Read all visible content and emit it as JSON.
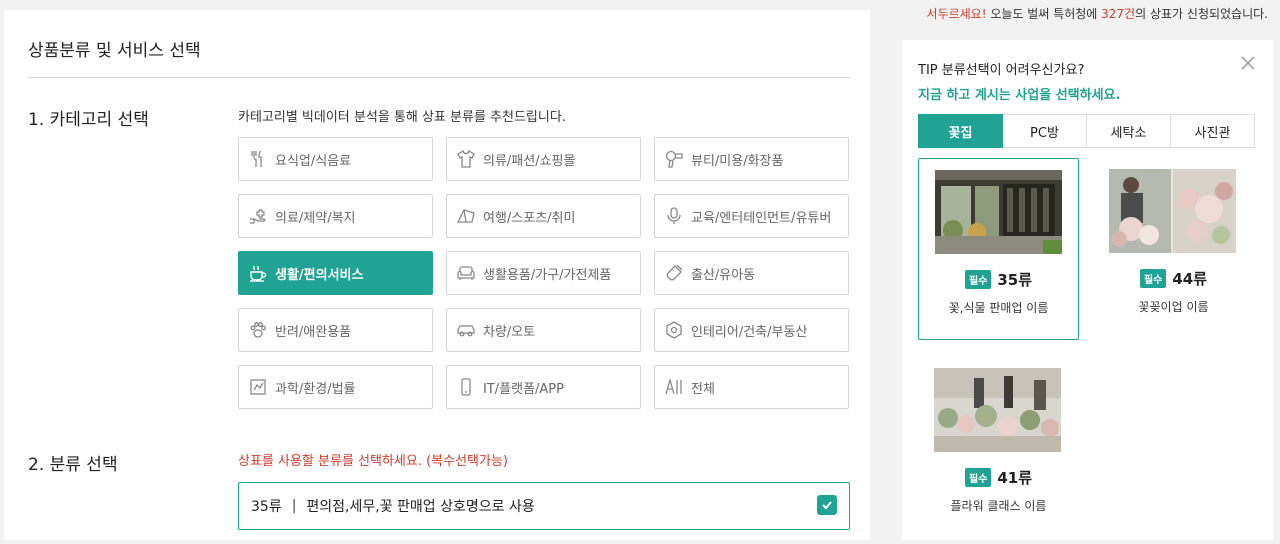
{
  "urgency": {
    "prefix": "서두르세요!",
    "middle": " 오늘도 벌써 특허청에 ",
    "count": "327건",
    "suffix": "의 상표가 신청되었습니다."
  },
  "page": {
    "title": "상품분류 및 서비스 선택"
  },
  "section1": {
    "title": "1. 카테고리 선택",
    "description": "카테고리별 빅데이터 분석을 통해 상표 분류를 추천드립니다."
  },
  "categories": [
    {
      "label": "요식업/식음료",
      "icon": "utensils-icon"
    },
    {
      "label": "의류/패션/쇼핑몰",
      "icon": "shirt-icon"
    },
    {
      "label": "뷰티/미용/화장품",
      "icon": "hair-dryer-icon"
    },
    {
      "label": "의료/제약/복지",
      "icon": "medical-hand-icon"
    },
    {
      "label": "여행/스포츠/취미",
      "icon": "tent-icon"
    },
    {
      "label": "교육/엔터테인먼트/유튜버",
      "icon": "microphone-icon"
    },
    {
      "label": "생활/편의서비스",
      "icon": "coffee-cup-icon",
      "active": true
    },
    {
      "label": "생활용품/가구/가전제품",
      "icon": "sofa-icon"
    },
    {
      "label": "출산/유아동",
      "icon": "baby-bottle-icon"
    },
    {
      "label": "반려/애완용품",
      "icon": "paw-icon"
    },
    {
      "label": "차량/오토",
      "icon": "car-icon"
    },
    {
      "label": "인테리어/건축/부동산",
      "icon": "building-icon"
    },
    {
      "label": "과학/환경/법률",
      "icon": "lab-icon"
    },
    {
      "label": "IT/플랫폼/APP",
      "icon": "smartphone-icon"
    },
    {
      "label": "전체",
      "icon": "all-icon"
    }
  ],
  "section2": {
    "title": "2. 분류 선택",
    "hint": "상표를 사용할 분류를 선택하세요. (복수선택가능)",
    "selected": {
      "class": "35류",
      "separator": "|",
      "description": "편의점,세무,꽃 판매업 상호명으로 사용"
    }
  },
  "tip": {
    "title": "TIP 분류선택이 어려우신가요?",
    "subtitle": "지금 하고 계시는 사업을 선택하세요.",
    "tabs": [
      {
        "label": "꽃집",
        "active": true
      },
      {
        "label": "PC방"
      },
      {
        "label": "세탁소"
      },
      {
        "label": "사진관"
      }
    ],
    "cards": [
      {
        "badge": "필수",
        "class": "35류",
        "name": "꽃,식물 판매업 이름",
        "selected": true
      },
      {
        "badge": "필수",
        "class": "44류",
        "name": "꽃꽂이업 이름"
      },
      {
        "badge": "필수",
        "class": "41류",
        "name": "플라워 클래스 이름"
      }
    ]
  },
  "colors": {
    "accent": "#20a393",
    "warning": "#d33a2c"
  }
}
